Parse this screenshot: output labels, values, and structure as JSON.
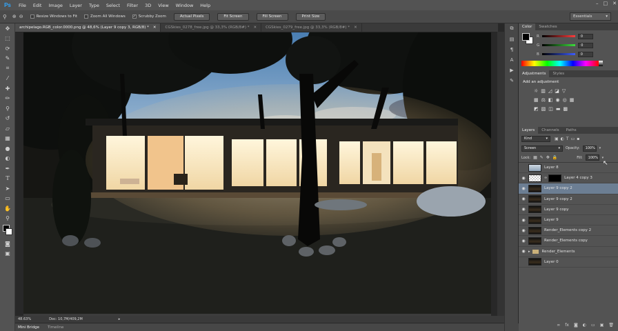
{
  "app": {
    "logo": "Ps"
  },
  "menu": [
    "File",
    "Edit",
    "Image",
    "Layer",
    "Type",
    "Select",
    "Filter",
    "3D",
    "View",
    "Window",
    "Help"
  ],
  "window_controls": [
    "–",
    "□",
    "✕"
  ],
  "options_bar": {
    "checkboxes": [
      {
        "label": "Resize Windows to Fit",
        "checked": false
      },
      {
        "label": "Zoom All Windows",
        "checked": false
      },
      {
        "label": "Scrubby Zoom",
        "checked": true
      }
    ],
    "buttons": [
      "Actual Pixels",
      "Fit Screen",
      "Fill Screen",
      "Print Size"
    ],
    "workspace": "Essentials"
  },
  "document_tabs": [
    {
      "title": "archipelago.RGB_color.0000.png @ 48,6% (Layer 9 copy 3, RGB/8) *",
      "active": true
    },
    {
      "title": "CGSkies_0278_free.jpg @ 33,3% (RGB/8#) *",
      "active": false
    },
    {
      "title": "CGSkies_0279_free.jpg @ 33,3% (RGB/8#) *",
      "active": false
    }
  ],
  "status_bar": {
    "zoom": "48.63%",
    "doc": "Doc: 10,7M/409,2M"
  },
  "bottom_tabs": [
    "Mini Bridge",
    "Timeline"
  ],
  "color_panel": {
    "tabs": [
      "Color",
      "Swatches"
    ],
    "channels": [
      {
        "label": "R",
        "value": "0",
        "color": "#ff3c3c"
      },
      {
        "label": "G",
        "value": "0",
        "color": "#3cdc3c"
      },
      {
        "label": "B",
        "value": "0",
        "color": "#3c5cff"
      }
    ]
  },
  "adjustments_panel": {
    "tabs": [
      "Adjustments",
      "Styles"
    ],
    "heading": "Add an adjustment"
  },
  "layers_panel": {
    "tabs": [
      "Layers",
      "Channels",
      "Paths"
    ],
    "filter": "Kind",
    "blend_mode": "Screen",
    "opacity_label": "Opacity:",
    "opacity": "100%",
    "lock_label": "Lock:",
    "fill_label": "Fill:",
    "fill": "100%",
    "layers": [
      {
        "name": "Layer 8",
        "visible": false,
        "selected": false,
        "thumb": "sky"
      },
      {
        "name": "Layer 4 copy 3",
        "visible": true,
        "selected": false,
        "thumb": "checker"
      },
      {
        "name": "Layer 9 copy 2",
        "visible": true,
        "selected": true,
        "thumb": "scene"
      },
      {
        "name": "Layer 9 copy 2",
        "visible": true,
        "selected": false,
        "thumb": "scene"
      },
      {
        "name": "Layer 9 copy",
        "visible": true,
        "selected": false,
        "thumb": "scene"
      },
      {
        "name": "Layer 9",
        "visible": true,
        "selected": false,
        "thumb": "scene"
      },
      {
        "name": "Render_Elements copy 2",
        "visible": true,
        "selected": false,
        "thumb": "scene"
      },
      {
        "name": "Render_Elements copy",
        "visible": true,
        "selected": false,
        "thumb": "scene"
      },
      {
        "name": "Render_Elements",
        "visible": true,
        "selected": false,
        "thumb": "folder"
      },
      {
        "name": "Layer 0",
        "visible": false,
        "selected": false,
        "thumb": "scene"
      }
    ]
  }
}
